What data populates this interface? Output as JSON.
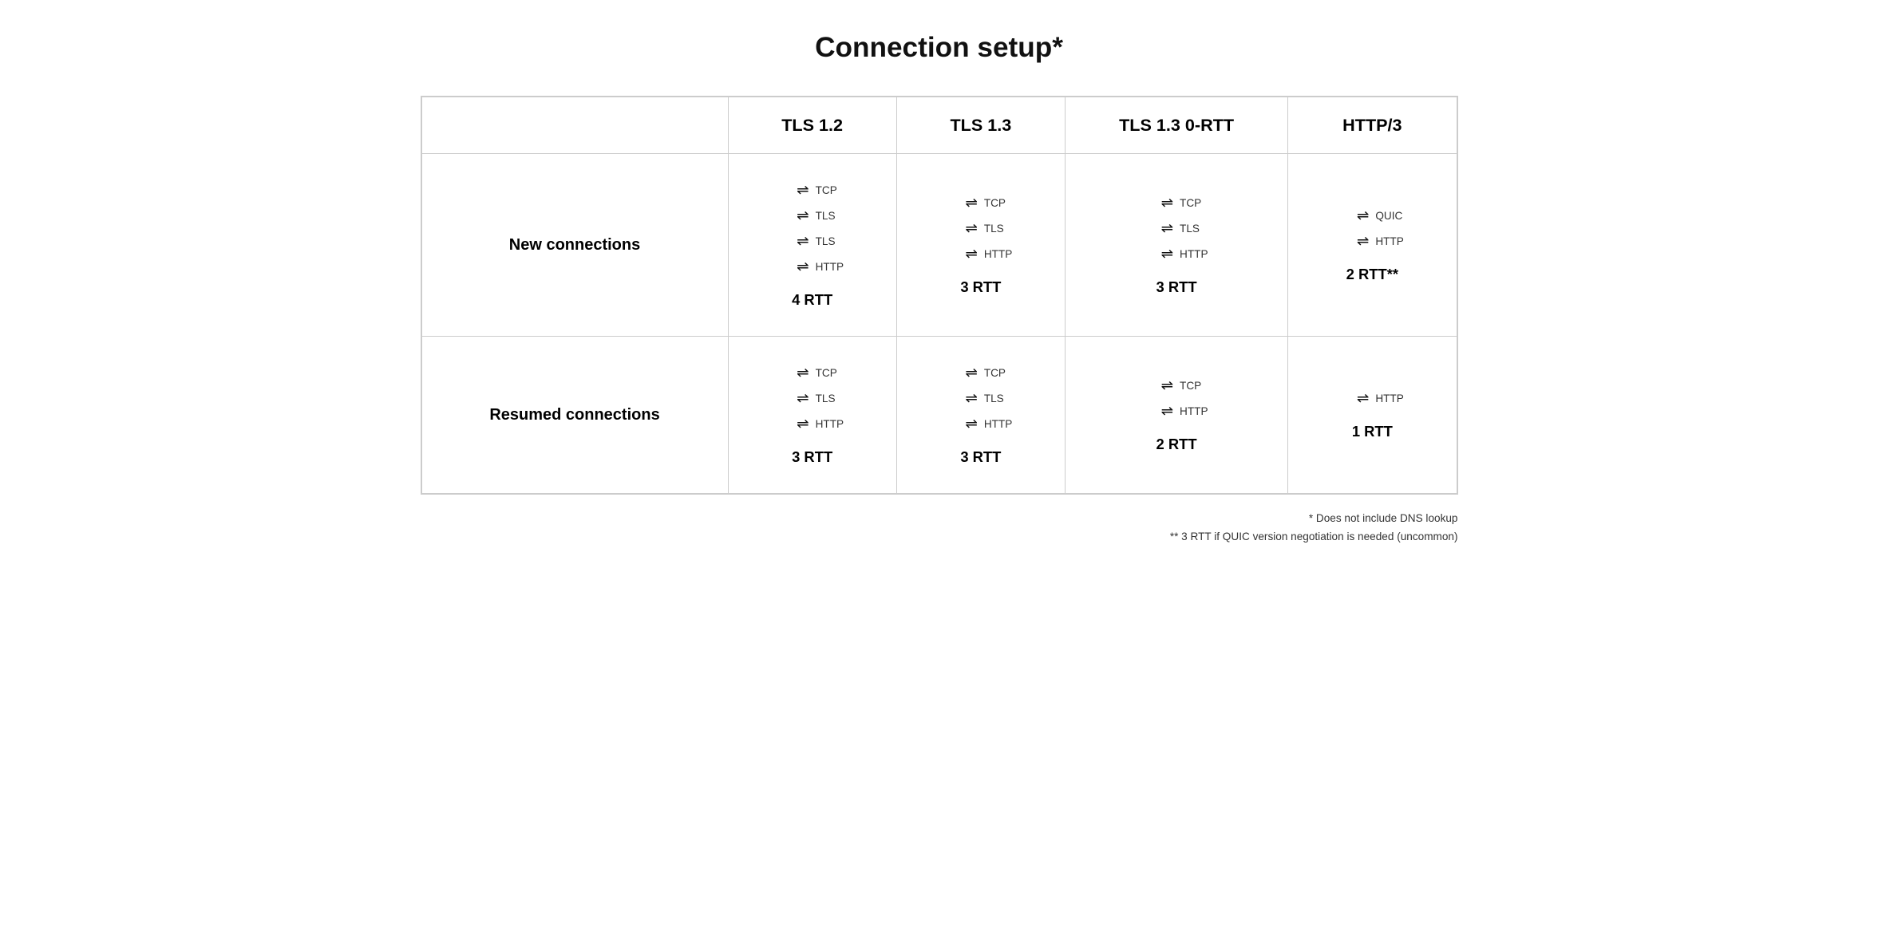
{
  "title": "Connection setup*",
  "columns": [
    "",
    "TLS 1.2",
    "TLS 1.3",
    "TLS 1.3 0-RTT",
    "HTTP/3"
  ],
  "rows": [
    {
      "header": "New\nconnections",
      "cells": [
        {
          "steps": [
            {
              "arrow": "⇌",
              "label": "TCP"
            },
            {
              "arrow": "⇌",
              "label": "TLS"
            },
            {
              "arrow": "⇌",
              "label": "TLS"
            },
            {
              "arrow": "⇌",
              "label": "HTTP"
            }
          ],
          "rtt": "4 RTT"
        },
        {
          "steps": [
            {
              "arrow": "⇌",
              "label": "TCP"
            },
            {
              "arrow": "⇌",
              "label": "TLS"
            },
            {
              "arrow": "⇌",
              "label": "HTTP"
            }
          ],
          "rtt": "3 RTT"
        },
        {
          "steps": [
            {
              "arrow": "⇌",
              "label": "TCP"
            },
            {
              "arrow": "⇌",
              "label": "TLS"
            },
            {
              "arrow": "⇌",
              "label": "HTTP"
            }
          ],
          "rtt": "3 RTT"
        },
        {
          "steps": [
            {
              "arrow": "⇌",
              "label": "QUIC"
            },
            {
              "arrow": "⇌",
              "label": "HTTP"
            }
          ],
          "rtt": "2 RTT**"
        }
      ]
    },
    {
      "header": "Resumed\nconnections",
      "cells": [
        {
          "steps": [
            {
              "arrow": "⇌",
              "label": "TCP"
            },
            {
              "arrow": "⇌",
              "label": "TLS"
            },
            {
              "arrow": "⇌",
              "label": "HTTP"
            }
          ],
          "rtt": "3 RTT"
        },
        {
          "steps": [
            {
              "arrow": "⇌",
              "label": "TCP"
            },
            {
              "arrow": "⇌",
              "label": "TLS"
            },
            {
              "arrow": "⇌",
              "label": "HTTP"
            }
          ],
          "rtt": "3 RTT"
        },
        {
          "steps": [
            {
              "arrow": "⇌",
              "label": "TCP"
            },
            {
              "arrow": "⇌",
              "label": "HTTP"
            }
          ],
          "rtt": "2 RTT"
        },
        {
          "steps": [
            {
              "arrow": "⇌",
              "label": "HTTP"
            }
          ],
          "rtt": "1 RTT"
        }
      ]
    }
  ],
  "footnotes": [
    "* Does not include DNS lookup",
    "** 3 RTT if QUIC version negotiation is needed (uncommon)"
  ]
}
